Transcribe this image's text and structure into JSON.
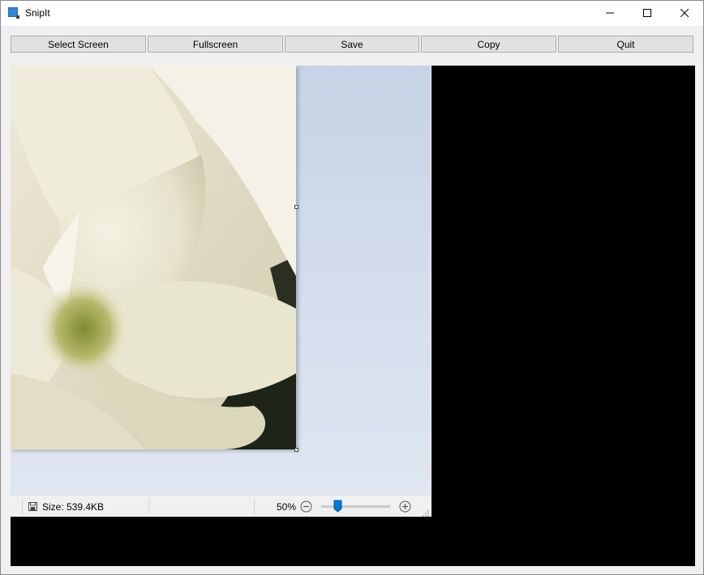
{
  "window": {
    "title": "SnipIt",
    "app_icon": "snipit-app-icon",
    "controls": {
      "minimize_icon": "minimize-icon",
      "maximize_icon": "maximize-icon",
      "close_icon": "close-icon"
    }
  },
  "toolbar": {
    "buttons": [
      {
        "label": "Select Screen"
      },
      {
        "label": "Fullscreen"
      },
      {
        "label": "Save"
      },
      {
        "label": "Copy"
      },
      {
        "label": "Quit"
      }
    ]
  },
  "preview": {
    "image_subject": "white amaryllis flower close-up",
    "background_color": "#cfd9ea"
  },
  "statusbar": {
    "size_icon": "save-disk-icon",
    "size_text": "Size: 539.4KB",
    "zoom_text": "50%",
    "zoom_level_percent": 50,
    "zoom_out_icon": "zoom-out-icon",
    "zoom_in_icon": "zoom-in-icon"
  },
  "colors": {
    "accent": "#0078d7",
    "empty_area": "#000000"
  }
}
